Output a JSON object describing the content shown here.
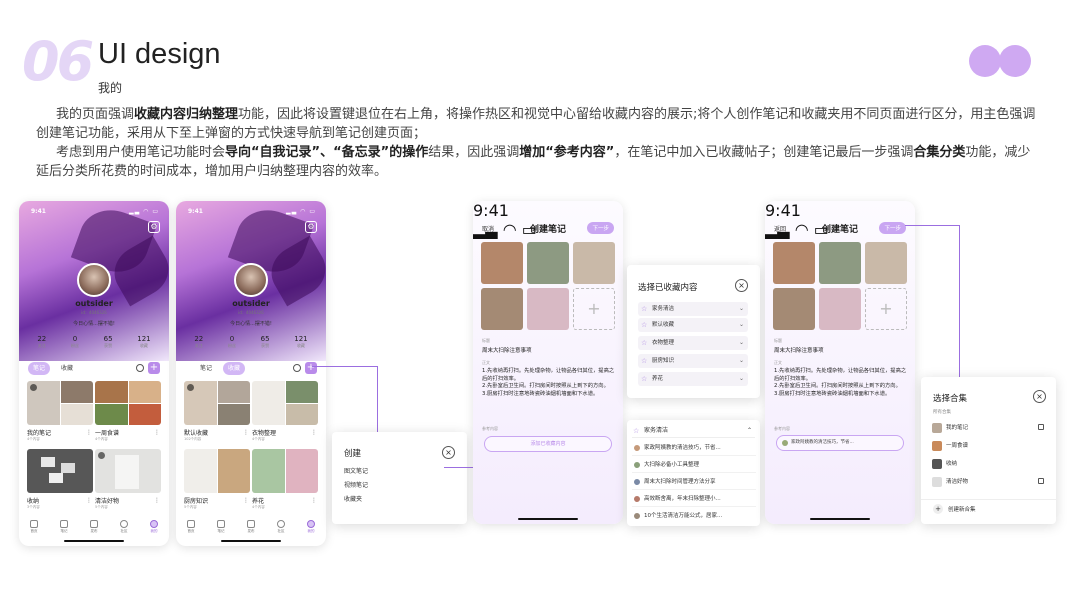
{
  "header": {
    "number": "06",
    "title": "UI design",
    "subtitle": "我的",
    "para1_a": "我的页面强调",
    "para1_b": "收藏内容归纳整理",
    "para1_c": "功能，因此将设置键退位在右上角，将操作热区和视觉中心留给收藏内容的展示;将个人创作笔记和收藏夹用不同页面进行区分，用主色强调创建笔记功能，采用从下至上弹窗的方式快速导航到笔记创建页面；",
    "para2_a": "考虑到用户使用笔记功能时会",
    "para2_b": "导向“自我记录”、“备忘录”的操作",
    "para2_c": "结果，因此强调",
    "para2_d": "增加“参考内容”",
    "para2_e": "，在笔记中加入已收藏帖子；创建笔记最后一步强调",
    "para2_f": "合集分类",
    "para2_g": "功能，减少延后分类所花费的时间成本，增加用户归纳整理内容的效率。"
  },
  "colors": {
    "accent": "#b98bea",
    "accent_light": "#d2b7f5",
    "number": "#e4d6f6"
  },
  "profile": {
    "time": "9:41",
    "username": "outsider",
    "id": "id：4046326",
    "mood": "今日心情...摆不错!",
    "stats": [
      {
        "n": "22",
        "l": "关注"
      },
      {
        "n": "0",
        "l": "粉丝"
      },
      {
        "n": "65",
        "l": "获赞"
      },
      {
        "n": "121",
        "l": "收藏"
      }
    ],
    "tab_notes": "笔记",
    "tab_collect": "收藏"
  },
  "phone1_cards": [
    {
      "title": "我的笔记",
      "sub": "4个内容"
    },
    {
      "title": "一周食谱",
      "sub": "4个内容"
    },
    {
      "title": "收纳",
      "sub": "3个内容"
    },
    {
      "title": "清洁好物",
      "sub": "5个内容"
    }
  ],
  "phone2_cards": [
    {
      "title": "默认收藏",
      "sub": "102个内容"
    },
    {
      "title": "衣物整理",
      "sub": "4个内容"
    },
    {
      "title": "厨房知识",
      "sub": "5个内容"
    },
    {
      "title": "养花",
      "sub": "4个内容"
    }
  ],
  "tabbar": [
    "首页",
    "笔记",
    "发布",
    "社区",
    "我的"
  ],
  "create_popup": {
    "title": "创建",
    "close": "×",
    "items": [
      "图文笔记",
      "视频笔记",
      "收藏夹"
    ]
  },
  "create_note": {
    "cancel": "取消",
    "back": "返回",
    "title": "创建笔记",
    "next": "下一步",
    "add": "+",
    "title_label": "标题",
    "title_value": "周末大扫除注意事项",
    "body_label": "正文",
    "body": [
      "1.先收纳再打扫。先处理杂物，让物品各归其位，提高之后的打扫效率。",
      "2.先卧室后卫生间。打扫房间时按照从上到下的方向。",
      "3.厨房打扫时注意地砖瓷砖油烟机墙面和下水道。"
    ],
    "ref_label": "参考内容",
    "ref_btn": "添加已收藏内容",
    "ref_chip": "家政阿姨教的清洁技巧，节省..."
  },
  "select_popup": {
    "title": "选择已收藏内容",
    "close": "×",
    "categories": [
      "家务清洁",
      "默认收藏",
      "衣物整理",
      "厨房知识",
      "养花"
    ],
    "expanded_title": "家务清洁",
    "expanded_items": [
      "家政阿姨教的清洁技巧，节省...",
      "大扫除必备小工具整理",
      "周末大扫除时间管理方法分享",
      "高效断舍离，年末扫除整理小...",
      "10个生活清洁万能公式，居家..."
    ]
  },
  "collection_popup": {
    "title": "选择合集",
    "close": "×",
    "label": "所有合集",
    "items": [
      "我的笔记",
      "一周食谱",
      "收纳",
      "清洁好物"
    ],
    "create": "创建新合集",
    "create_icon": "+"
  }
}
